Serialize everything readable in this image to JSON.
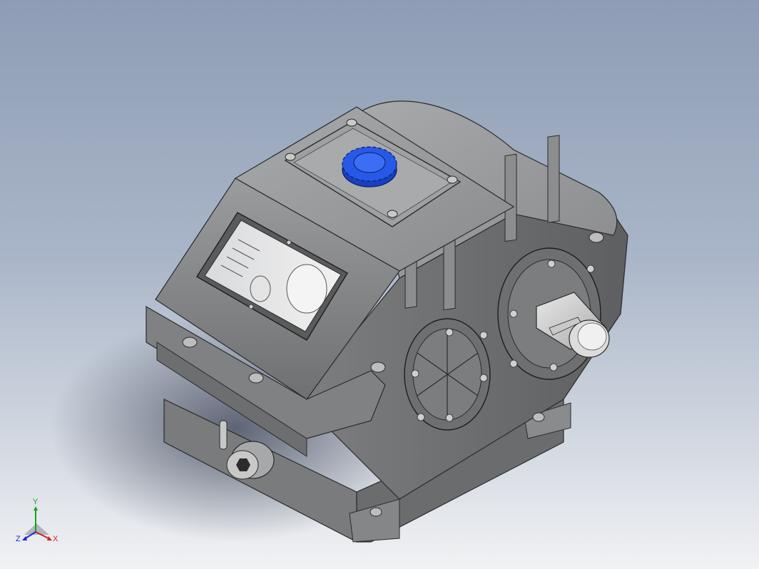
{
  "viewport": {
    "background_top": "#8e9db5",
    "background_bottom": "#f1f2f4",
    "model_body_color": "#8f9092",
    "knob_color": "#1f4fd8"
  },
  "triad": {
    "x_label": "X",
    "y_label": "Y",
    "z_label": "Z",
    "x_color": "#d42020",
    "y_color": "#1aa01a",
    "z_color": "#1a2ad4"
  }
}
